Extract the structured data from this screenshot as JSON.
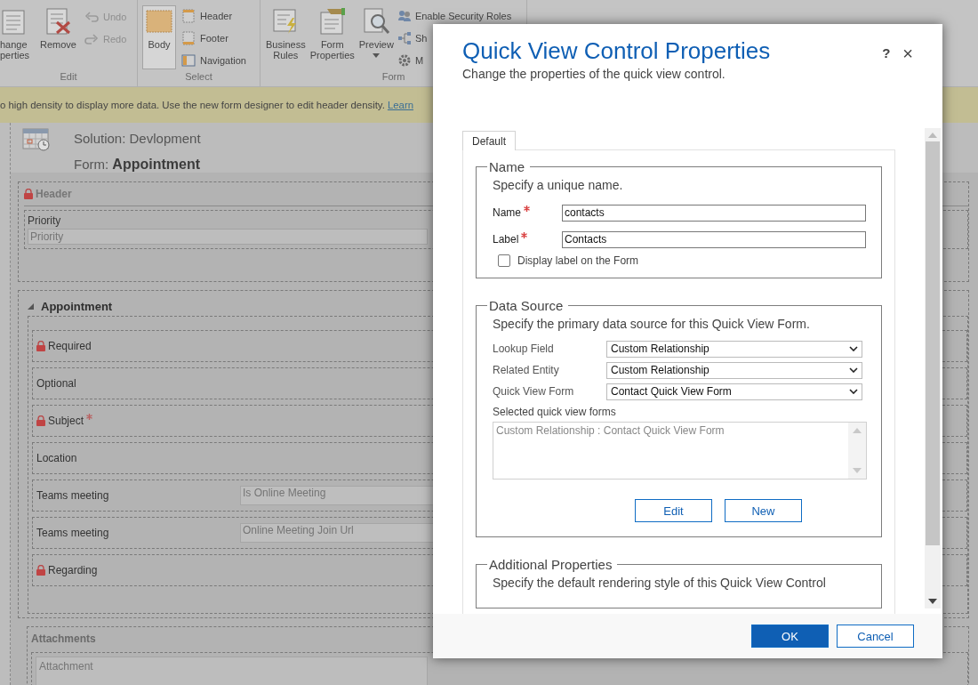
{
  "ribbon": {
    "groups": [
      {
        "label": "Edit",
        "items": [
          {
            "kind": "large",
            "label": "hange\nperties",
            "selected": false
          },
          {
            "kind": "large",
            "label": "Remove",
            "selected": false
          },
          {
            "kind": "stack",
            "items": [
              {
                "label": "Undo",
                "disabled": true
              },
              {
                "label": "Redo",
                "disabled": true
              }
            ]
          }
        ]
      },
      {
        "label": "Select",
        "items": [
          {
            "kind": "large",
            "label": "Body",
            "selected": true
          },
          {
            "kind": "stack",
            "items": [
              {
                "label": "Header",
                "disabled": false
              },
              {
                "label": "Footer",
                "disabled": false
              },
              {
                "label": "Navigation",
                "disabled": false
              }
            ]
          }
        ]
      },
      {
        "label": "Form",
        "items": [
          {
            "kind": "large",
            "label": "Business\nRules",
            "selected": false
          },
          {
            "kind": "large",
            "label": "Form\nProperties",
            "selected": false
          },
          {
            "kind": "dropdown",
            "label": "Preview",
            "selected": false
          },
          {
            "kind": "stack",
            "items": [
              {
                "label": "Enable Security Roles",
                "disabled": false
              },
              {
                "label": "Sh",
                "disabled": false
              },
              {
                "label": "M",
                "disabled": false
              }
            ]
          }
        ]
      }
    ]
  },
  "notice": {
    "text": "o high density to display more data. Use the new form designer to edit header density.",
    "link": "Learn"
  },
  "designer": {
    "solution": "Solution: Devlopment",
    "form_label": "Form:",
    "form_name": "Appointment",
    "header_section": {
      "title": "Header",
      "locked": true,
      "fields": [
        {
          "label": "Priority",
          "placeholder": "Priority"
        }
      ]
    },
    "sections": [
      {
        "title": "Appointment",
        "expanded": true,
        "rows": [
          {
            "label": "Required",
            "locked": true,
            "required": false
          },
          {
            "label": "Optional",
            "locked": false,
            "required": false
          },
          {
            "label": "Subject",
            "locked": true,
            "required": true
          },
          {
            "label": "Location",
            "locked": false,
            "required": false
          },
          {
            "label": "Teams meeting",
            "locked": false,
            "required": false,
            "placeholder": "Is Online Meeting"
          },
          {
            "label": "Teams meeting",
            "locked": false,
            "required": false,
            "placeholder": "Online Meeting Join Url"
          },
          {
            "label": "Regarding",
            "locked": true,
            "required": false
          }
        ]
      }
    ],
    "attachments": {
      "title": "Attachments",
      "placeholder": "Attachment"
    }
  },
  "dialog": {
    "title": "Quick View Control Properties",
    "subtitle": "Change the properties of the quick view control.",
    "help": "?",
    "close": "×",
    "tabs": [
      {
        "label": "Default",
        "selected": true
      }
    ],
    "name_group": {
      "legend": "Name",
      "hint": "Specify a unique name.",
      "fields": [
        {
          "label": "Name",
          "required": true,
          "value": "contacts"
        },
        {
          "label": "Label",
          "required": true,
          "value": "Contacts"
        }
      ],
      "checkbox": {
        "label": "Display label on the Form",
        "checked": false
      }
    },
    "data_source": {
      "legend": "Data Source",
      "hint": "Specify the primary data source for this Quick View Form.",
      "selects": [
        {
          "label": "Lookup Field",
          "value": "Custom Relationship"
        },
        {
          "label": "Related Entity",
          "value": "Custom Relationship"
        },
        {
          "label": "Quick View Form",
          "value": "Contact Quick View Form"
        }
      ],
      "list_label": "Selected quick view forms",
      "list_items": [
        "Custom Relationship : Contact Quick View Form"
      ],
      "buttons": [
        "Edit",
        "New"
      ]
    },
    "additional": {
      "legend": "Additional Properties",
      "hint": "Specify the default rendering style of this Quick View Control"
    },
    "footer_buttons": [
      {
        "label": "OK",
        "primary": true
      },
      {
        "label": "Cancel",
        "primary": false
      }
    ]
  }
}
